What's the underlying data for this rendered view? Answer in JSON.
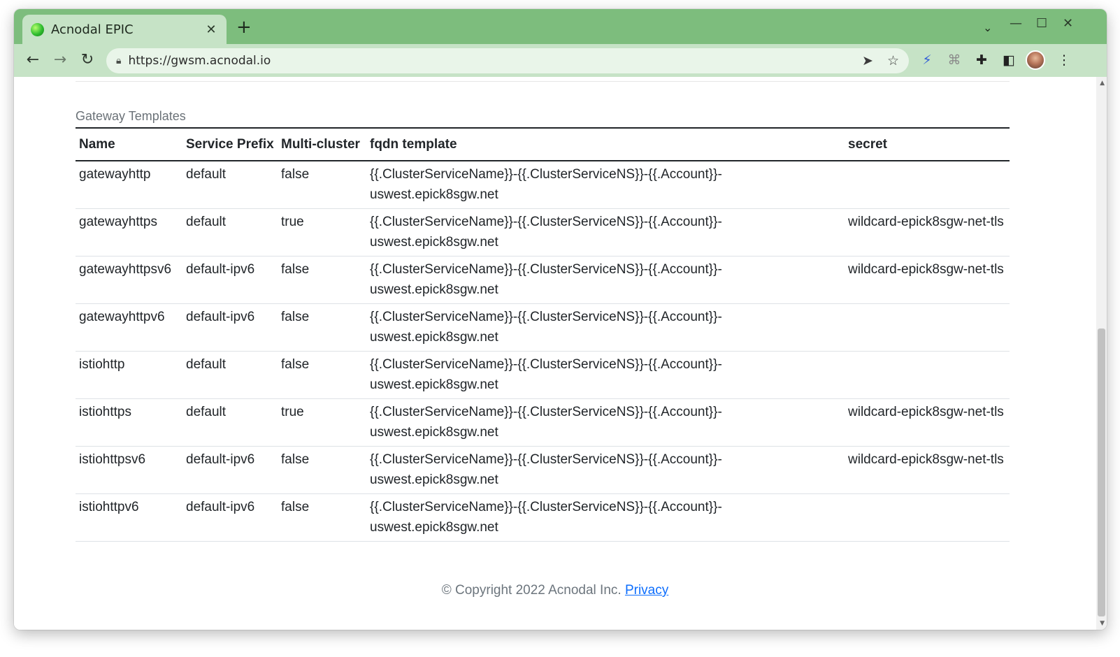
{
  "browser": {
    "tab_title": "Acnodal EPIC",
    "tab_close": "✕",
    "new_tab": "+",
    "tab_search": "⌄",
    "url": "https://gwsm.acnodal.io",
    "window_controls": {
      "minimize": "—",
      "maximize": "☐",
      "close": "✕"
    },
    "nav": {
      "back": "←",
      "forward": "→",
      "reload": "↻"
    }
  },
  "page": {
    "section_title": "Gateway Templates",
    "table": {
      "headers": [
        "Name",
        "Service Prefix",
        "Multi-cluster",
        "fqdn template",
        "secret"
      ],
      "rows": [
        {
          "name": "gatewayhttp",
          "service_prefix": "default",
          "multi_cluster": "false",
          "fqdn_template": "{{.ClusterServiceName}}-{{.ClusterServiceNS}}-{{.Account}}-uswest.epick8sgw.net",
          "secret": ""
        },
        {
          "name": "gatewayhttps",
          "service_prefix": "default",
          "multi_cluster": "true",
          "fqdn_template": "{{.ClusterServiceName}}-{{.ClusterServiceNS}}-{{.Account}}-uswest.epick8sgw.net",
          "secret": "wildcard-epick8sgw-net-tls"
        },
        {
          "name": "gatewayhttpsv6",
          "service_prefix": "default-ipv6",
          "multi_cluster": "false",
          "fqdn_template": "{{.ClusterServiceName}}-{{.ClusterServiceNS}}-{{.Account}}-uswest.epick8sgw.net",
          "secret": "wildcard-epick8sgw-net-tls"
        },
        {
          "name": "gatewayhttpv6",
          "service_prefix": "default-ipv6",
          "multi_cluster": "false",
          "fqdn_template": "{{.ClusterServiceName}}-{{.ClusterServiceNS}}-{{.Account}}-uswest.epick8sgw.net",
          "secret": ""
        },
        {
          "name": "istiohttp",
          "service_prefix": "default",
          "multi_cluster": "false",
          "fqdn_template": "{{.ClusterServiceName}}-{{.ClusterServiceNS}}-{{.Account}}-uswest.epick8sgw.net",
          "secret": ""
        },
        {
          "name": "istiohttps",
          "service_prefix": "default",
          "multi_cluster": "true",
          "fqdn_template": "{{.ClusterServiceName}}-{{.ClusterServiceNS}}-{{.Account}}-uswest.epick8sgw.net",
          "secret": "wildcard-epick8sgw-net-tls"
        },
        {
          "name": "istiohttpsv6",
          "service_prefix": "default-ipv6",
          "multi_cluster": "false",
          "fqdn_template": "{{.ClusterServiceName}}-{{.ClusterServiceNS}}-{{.Account}}-uswest.epick8sgw.net",
          "secret": "wildcard-epick8sgw-net-tls"
        },
        {
          "name": "istiohttpv6",
          "service_prefix": "default-ipv6",
          "multi_cluster": "false",
          "fqdn_template": "{{.ClusterServiceName}}-{{.ClusterServiceNS}}-{{.Account}}-uswest.epick8sgw.net",
          "secret": ""
        }
      ]
    },
    "footer": {
      "copyright": "© Copyright 2022 Acnodal Inc.",
      "privacy_link": "Privacy"
    }
  },
  "colors": {
    "tabbar": "#7dbd7d",
    "toolbar": "#c6e3c6",
    "link": "#0d6efd",
    "text": "#212529",
    "muted": "#6c757d"
  },
  "icons": [
    "favicon-globe-icon",
    "close-icon",
    "plus-icon",
    "chevron-down-icon",
    "minimize-icon",
    "maximize-icon",
    "back-arrow-icon",
    "forward-arrow-icon",
    "reload-icon",
    "lock-icon",
    "send-icon",
    "star-icon",
    "bolt-icon",
    "extension-icon",
    "puzzle-icon",
    "side-panel-icon",
    "profile-avatar",
    "kebab-menu-icon"
  ]
}
